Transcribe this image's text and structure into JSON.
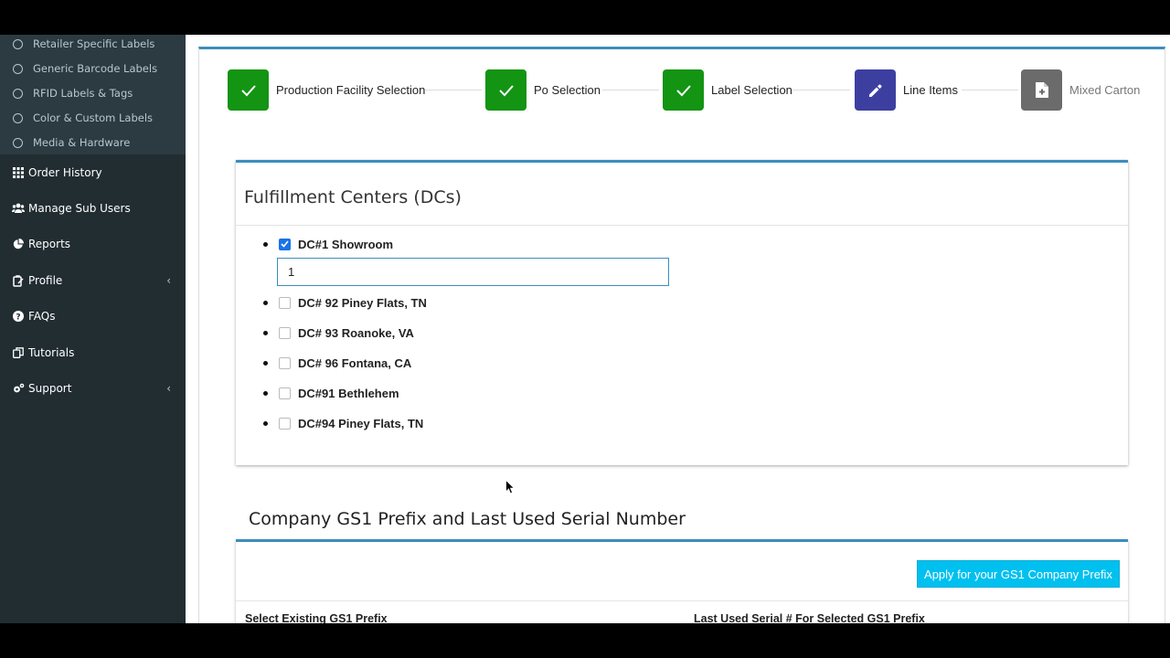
{
  "sidebar": {
    "sub_items": [
      {
        "label": "Retailer Specific Labels"
      },
      {
        "label": "Generic Barcode Labels"
      },
      {
        "label": "RFID Labels & Tags"
      },
      {
        "label": "Color & Custom Labels"
      },
      {
        "label": "Media & Hardware"
      }
    ],
    "nav_items": [
      {
        "label": "Order History",
        "icon": "grid-icon"
      },
      {
        "label": "Manage Sub Users",
        "icon": "users-icon"
      },
      {
        "label": "Reports",
        "icon": "pie-chart-icon"
      },
      {
        "label": "Profile",
        "icon": "clipboard-icon"
      },
      {
        "label": "FAQs",
        "icon": "question-circle-icon"
      },
      {
        "label": "Tutorials",
        "icon": "copy-icon"
      },
      {
        "label": "Support",
        "icon": "cogs-icon"
      }
    ]
  },
  "wizard": {
    "steps": [
      {
        "label": "Production Facility Selection",
        "state": "done",
        "color": "#139413"
      },
      {
        "label": "Po Selection",
        "state": "done",
        "color": "#139413"
      },
      {
        "label": "Label Selection",
        "state": "done",
        "color": "#139413"
      },
      {
        "label": "Line Items",
        "state": "active",
        "color": "#3d3fa0"
      },
      {
        "label": "Mixed Carton",
        "state": "pending",
        "color": "#6b6b6b"
      }
    ]
  },
  "fulfillment": {
    "title": "Fulfillment Centers (DCs)",
    "centers": [
      {
        "label": "DC#1 Showroom",
        "checked": true,
        "quantity": "1"
      },
      {
        "label": "DC# 92 Piney Flats, TN",
        "checked": false
      },
      {
        "label": "DC# 93 Roanoke, VA",
        "checked": false
      },
      {
        "label": "DC# 96 Fontana, CA",
        "checked": false
      },
      {
        "label": "DC#91 Bethlehem",
        "checked": false
      },
      {
        "label": "DC#94 Piney Flats, TN",
        "checked": false
      }
    ]
  },
  "gs1": {
    "title": "Company GS1 Prefix and Last Used Serial Number",
    "apply_button": "Apply for your GS1 Company Prefix",
    "select_label": "Select Existing GS1 Prefix",
    "serial_label": "Last Used Serial # For Selected GS1 Prefix"
  },
  "colors": {
    "sidebar_bg": "#222d32",
    "accent": "#3c8dbc",
    "info_button": "#00c0ef"
  }
}
